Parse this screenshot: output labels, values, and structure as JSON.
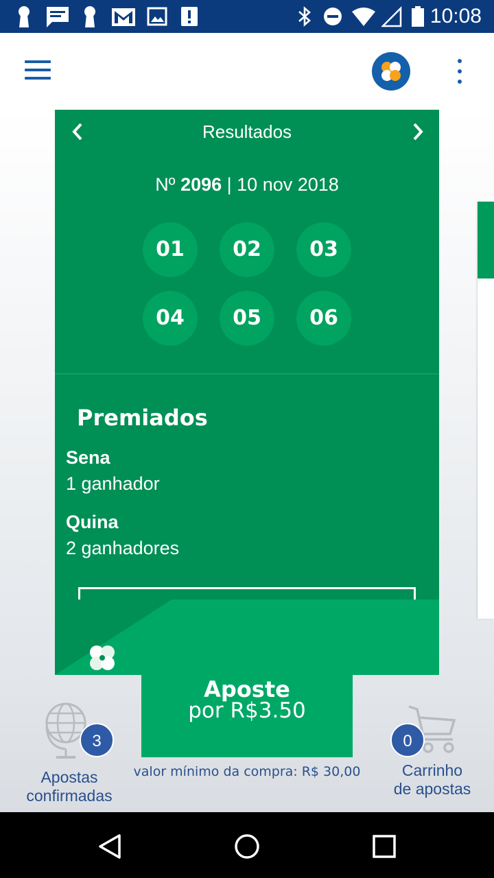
{
  "status_bar": {
    "time": "10:08",
    "icons": [
      "keyhole-icon",
      "message-icon",
      "keyhole-icon",
      "gmail-icon",
      "image-icon",
      "alert-icon",
      "bluetooth-icon",
      "dnd-icon",
      "wifi-icon",
      "signal-icon",
      "battery-icon"
    ]
  },
  "app_bar": {
    "menu_icon": "hamburger-icon",
    "logo_icon": "clover-logo-icon",
    "more_icon": "more-vert-icon"
  },
  "results_card": {
    "title": "Resultados",
    "draw_prefix": "Nº ",
    "draw_number": "2096",
    "draw_date": " | 10 nov 2018",
    "numbers": [
      "01",
      "02",
      "03",
      "04",
      "05",
      "06"
    ],
    "prizes_title": "Premiados",
    "tiers": [
      {
        "name": "Sena",
        "winners": "1 ganhador"
      },
      {
        "name": "Quina",
        "winners": "2 ganhadores"
      }
    ]
  },
  "bet": {
    "label": "Aposte",
    "price": "por R$3.50",
    "min_note": "valor mínimo da compra: R$ 30,00"
  },
  "confirmed_bets": {
    "count": "3",
    "label_line1": "Apostas",
    "label_line2": "confirmadas"
  },
  "cart": {
    "count": "0",
    "label_line1": "Carrinho",
    "label_line2": "de apostas"
  },
  "colors": {
    "status_bar": "#0b3b7c",
    "card_green": "#008f55",
    "ball_green": "#00a35f",
    "accent_green": "#00a866",
    "brand_blue": "#1460aa",
    "badge_blue": "#2f5aa6"
  }
}
